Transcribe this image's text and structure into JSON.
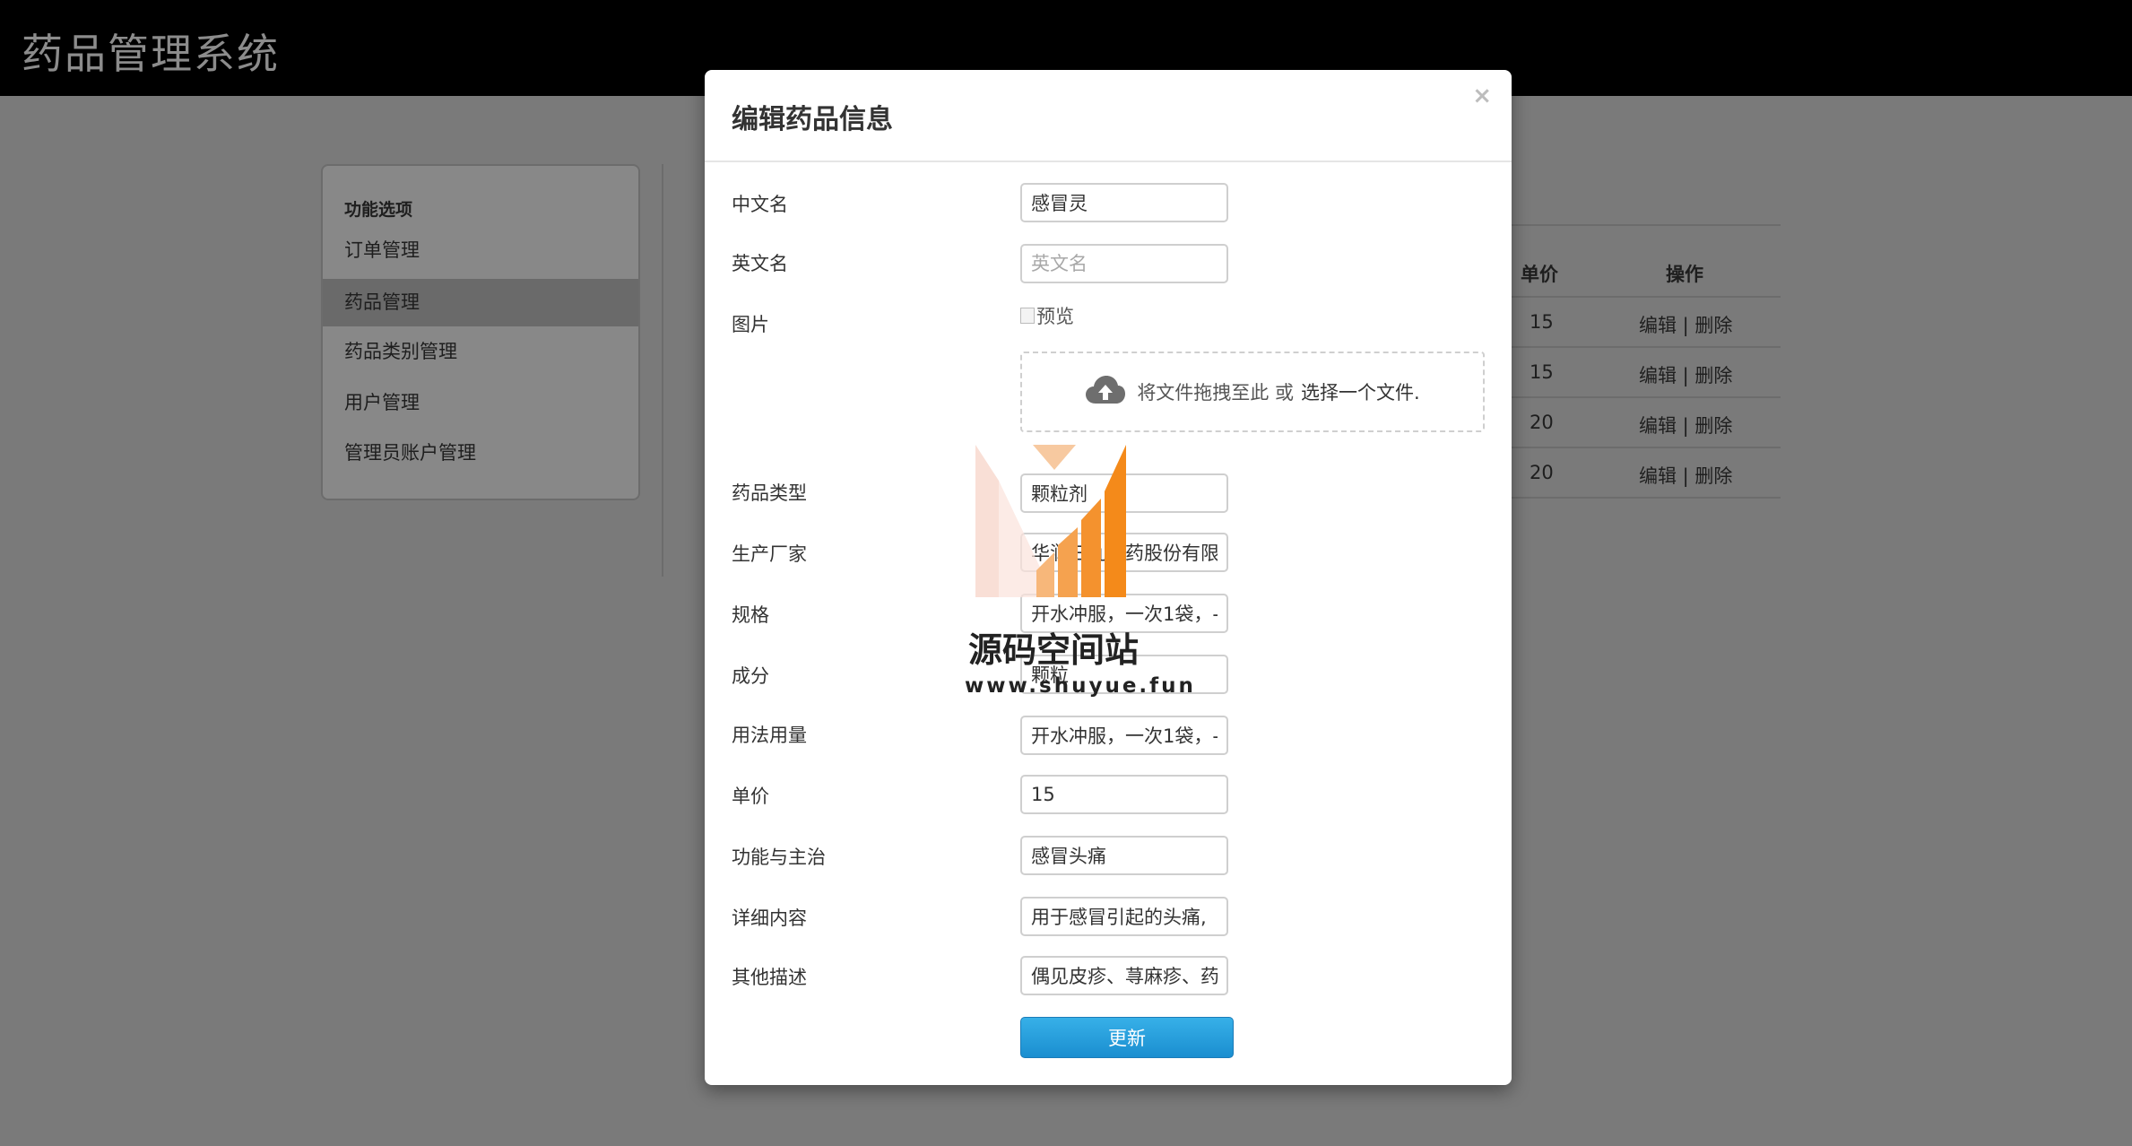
{
  "app": {
    "title": "药品管理系统"
  },
  "sidebar": {
    "heading": "功能选项",
    "items": [
      {
        "label": "订单管理",
        "active": false
      },
      {
        "label": "药品管理",
        "active": true
      },
      {
        "label": "药品类别管理",
        "active": false
      },
      {
        "label": "用户管理",
        "active": false
      },
      {
        "label": "管理员账户管理",
        "active": false
      }
    ]
  },
  "table": {
    "headers": {
      "price": "单价",
      "ops": "操作"
    },
    "rows": [
      {
        "price": "15",
        "ops": "编辑 | 删除"
      },
      {
        "price": "15",
        "ops": "编辑 | 删除"
      },
      {
        "price": "20",
        "ops": "编辑 | 删除"
      },
      {
        "price": "20",
        "ops": "编辑 | 删除"
      }
    ]
  },
  "modal": {
    "title": "编辑药品信息",
    "close": "×",
    "fields": {
      "cn_name": {
        "label": "中文名",
        "value": "感冒灵"
      },
      "en_name": {
        "label": "英文名",
        "value": "",
        "placeholder": "英文名"
      },
      "image": {
        "label": "图片",
        "preview_alt": "预览"
      },
      "type": {
        "label": "药品类型",
        "value": "颗粒剂"
      },
      "maker": {
        "label": "生产厂家",
        "value": "华润三九医药股份有限"
      },
      "spec": {
        "label": "规格",
        "value": "开水冲服，一次1袋，-"
      },
      "ingredients": {
        "label": "成分",
        "value": "颗粒"
      },
      "usage": {
        "label": "用法用量",
        "value": "开水冲服，一次1袋，-"
      },
      "price": {
        "label": "单价",
        "value": "15"
      },
      "function": {
        "label": "功能与主治",
        "value": "感冒头痛"
      },
      "detail": {
        "label": "详细内容",
        "value": "用于感冒引起的头痛,"
      },
      "other": {
        "label": "其他描述",
        "value": "偶见皮疹、荨麻疹、药"
      }
    },
    "dropzone": {
      "text": "将文件拖拽至此 或",
      "choose": "选择一个文件."
    },
    "submit_label": "更新"
  },
  "watermark": {
    "name": "源码空间站",
    "url": "www.shuyue.fun"
  },
  "colors": {
    "primary_button": "#1a8ed0",
    "navbar": "#000000",
    "watermark_orange": "#f48a1a"
  }
}
